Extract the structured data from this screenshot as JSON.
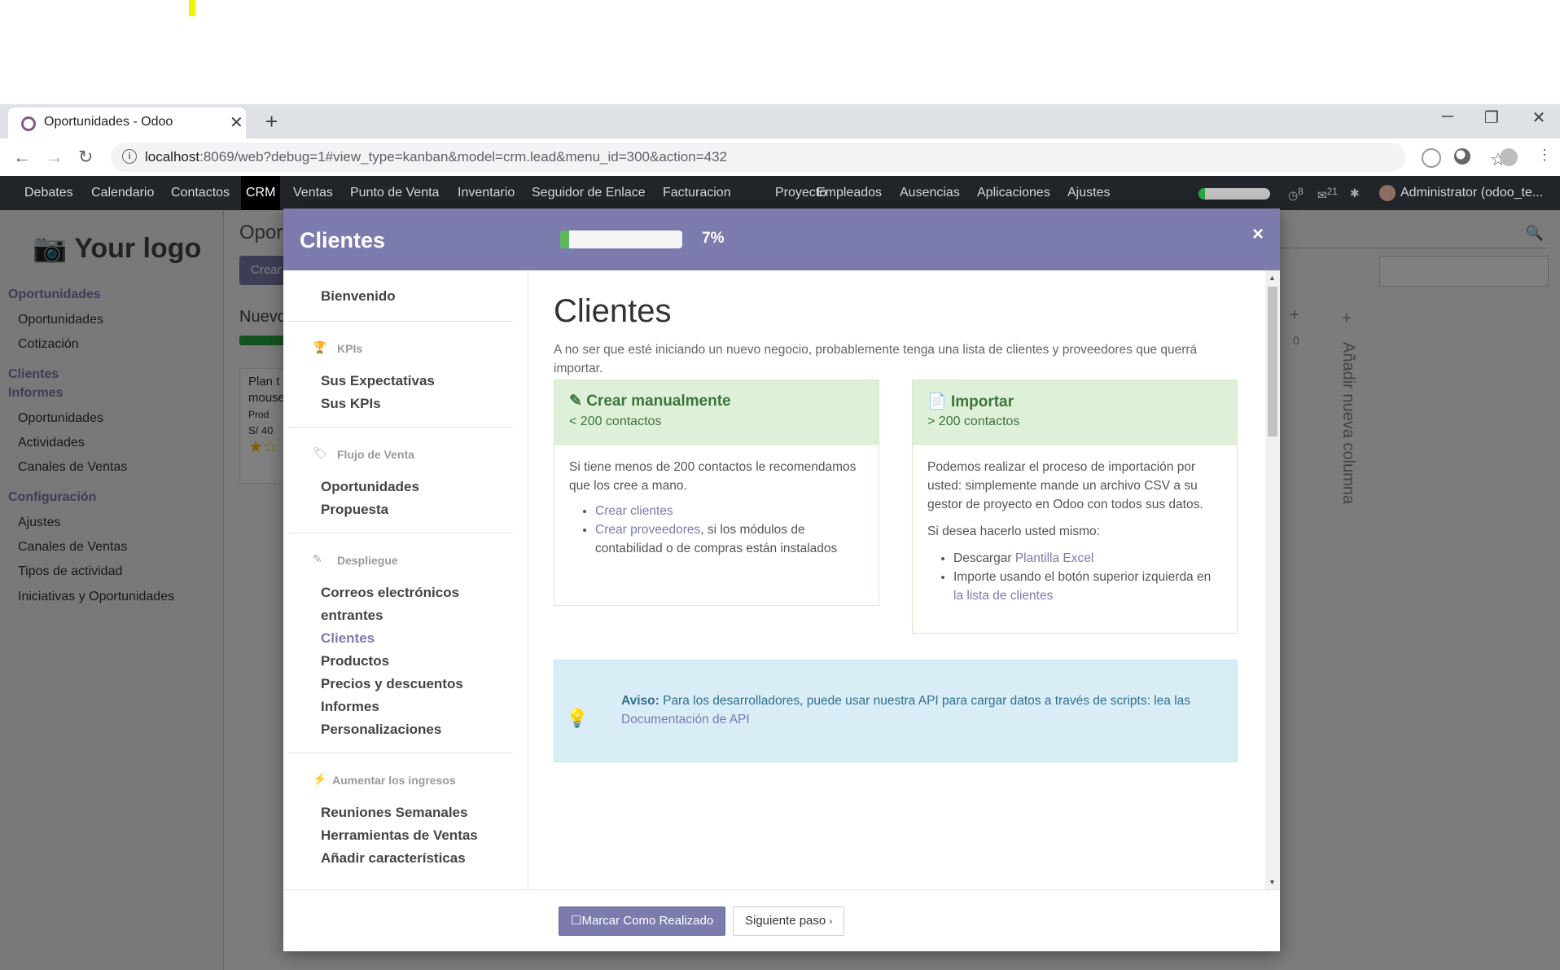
{
  "browser": {
    "tab_title": "Oportunidades - Odoo",
    "tab_close": "✕",
    "new_tab": "+",
    "url_host": "localhost",
    "url_rest": ":8069/web?debug=1#view_type=kanban&model=crm.lead&menu_id=300&action=432"
  },
  "odoo_nav": {
    "items": [
      "Debates",
      "Calendario",
      "Contactos",
      "CRM",
      "Ventas",
      "Punto de Venta",
      "Inventario",
      "Seguidor de Enlace",
      "Facturacion",
      "Proyecto",
      "Empleados",
      "Ausencias",
      "Aplicaciones",
      "Ajustes"
    ],
    "active": "CRM",
    "badge_activities": "8",
    "badge_messages": "21",
    "user": "Administrator (odoo_te..."
  },
  "background": {
    "logo": "Your logo",
    "title": "Oport",
    "create_label": "Crear",
    "column_title": "Nuevo",
    "column_zero": "0",
    "add_column": "Añadir nueva columna",
    "card_lines": [
      "Plan t",
      "mouse",
      "Prod",
      "S/ 40"
    ],
    "sidebar": [
      {
        "type": "h",
        "label": "Oportunidades"
      },
      {
        "type": "i",
        "label": "Oportunidades"
      },
      {
        "type": "i",
        "label": "Cotización"
      },
      {
        "type": "h",
        "label": "Clientes"
      },
      {
        "type": "h",
        "label": "Informes"
      },
      {
        "type": "i",
        "label": "Oportunidades"
      },
      {
        "type": "i",
        "label": "Actividades"
      },
      {
        "type": "i",
        "label": "Canales de Ventas"
      },
      {
        "type": "h",
        "label": "Configuración"
      },
      {
        "type": "i",
        "label": "Ajustes"
      },
      {
        "type": "i",
        "label": "Canales de Ventas"
      },
      {
        "type": "i",
        "label": "Tipos de actividad"
      },
      {
        "type": "i",
        "label": "Iniciativas y Oportunidades"
      }
    ]
  },
  "modal": {
    "title": "Clientes",
    "progress": 0.07,
    "progress_label": "7%",
    "close": "×",
    "nav": {
      "welcome": "Bienvenido",
      "sections": [
        {
          "icon": "trophy-icon",
          "label": "KPIs",
          "links": [
            "Sus Expectativas",
            "Sus KPIs"
          ]
        },
        {
          "icon": "tag-icon",
          "label": "Flujo de Venta",
          "links": [
            "Oportunidades",
            "Propuesta"
          ]
        },
        {
          "icon": "magic-icon",
          "label": "Despliegue",
          "links": [
            "Correos electrónicos",
            "entrantes",
            "Clientes",
            "Productos",
            "Precios y descuentos",
            "Informes",
            "Personalizaciones"
          ]
        },
        {
          "icon": "bolt-icon",
          "label": "Aumentar los ingresos",
          "links": [
            "Reuniones Semanales",
            "Herramientas de Ventas",
            "Añadir características"
          ]
        }
      ],
      "active": "Clientes"
    },
    "content": {
      "heading": "Clientes",
      "intro": "A no ser que esté iniciando un nuevo negocio, probablemente tenga una lista de clientes y proveedores que querrá importar.",
      "card1": {
        "title": "Crear manualmente",
        "sub": "< 200 contactos",
        "body": "Si tiene menos de 200 contactos le recomendamos que los cree a mano.",
        "link1": "Crear clientes",
        "link2": "Crear proveedores",
        "link2_rest": ", si los módulos de contabilidad o de compras están instalados"
      },
      "card2": {
        "title": "Importar",
        "sub": "> 200 contactos",
        "body": "Podemos realizar el proceso de importación por usted: simplemente mande un archivo CSV a su gestor de proyecto en Odoo con todos sus datos.",
        "body2": "Si desea hacerlo usted mismo:",
        "li1_text": "Descargar ",
        "li1_link": "Plantilla Excel",
        "li2_text": "Importe usando el botón superior izquierda en ",
        "li2_link": "la lista de clientes"
      },
      "notice": {
        "bold": "Aviso:",
        "text": " Para los desarrolladores, puede usar nuestra API para cargar datos a través de scripts: lea las ",
        "link": "Documentación de API"
      }
    },
    "footer": {
      "done": "Marcar Como Realizado",
      "next": "Siguiente paso"
    }
  }
}
